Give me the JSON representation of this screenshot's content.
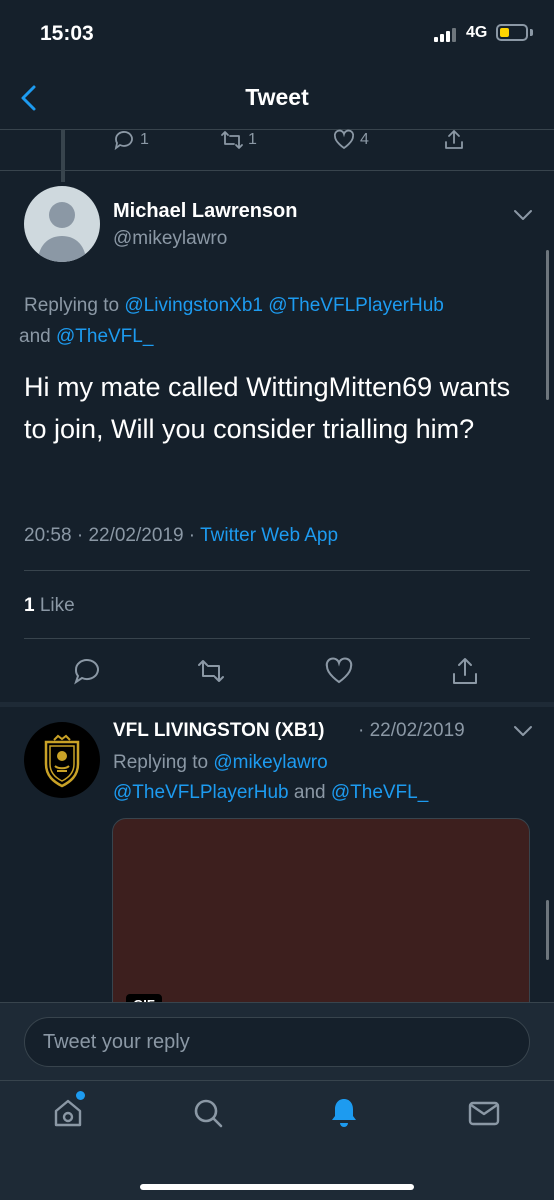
{
  "status_bar": {
    "time": "15:03",
    "network": "4G"
  },
  "header": {
    "title": "Tweet"
  },
  "previous_tweet_actions": {
    "replies": "1",
    "retweets": "1",
    "likes": "4"
  },
  "tweet": {
    "author_name": "Michael Lawrenson",
    "author_handle": "@mikeylawro",
    "replying_prefix": "Replying to ",
    "replying_user1": "@LivingstonXb1",
    "replying_user2": "@TheVFLPlayerHub",
    "replying_and": " and ",
    "replying_user3": "@TheVFL_",
    "text": "Hi my mate called WittingMitten69 wants to join, Will you consider trialling him?",
    "time": "20:58",
    "date": "22/02/2019",
    "separator": " · ",
    "source": "Twitter Web App",
    "like_count": "1",
    "like_label": " Like"
  },
  "reply_tweet": {
    "author_name": "VFL LIVINGSTON (XB1)",
    "date": " · 22/02/2019",
    "replying_prefix": "Replying to ",
    "replying_user1": "@mikeylawro",
    "replying_user2": "@TheVFLPlayerHub",
    "replying_and": " and ",
    "replying_user3": "@TheVFL_",
    "media_badge": "GIF"
  },
  "composer": {
    "placeholder": "Tweet your reply"
  },
  "colors": {
    "background": "#15202b",
    "accent": "#1d9bf0",
    "muted": "#8b98a5",
    "divider": "#38444d"
  }
}
